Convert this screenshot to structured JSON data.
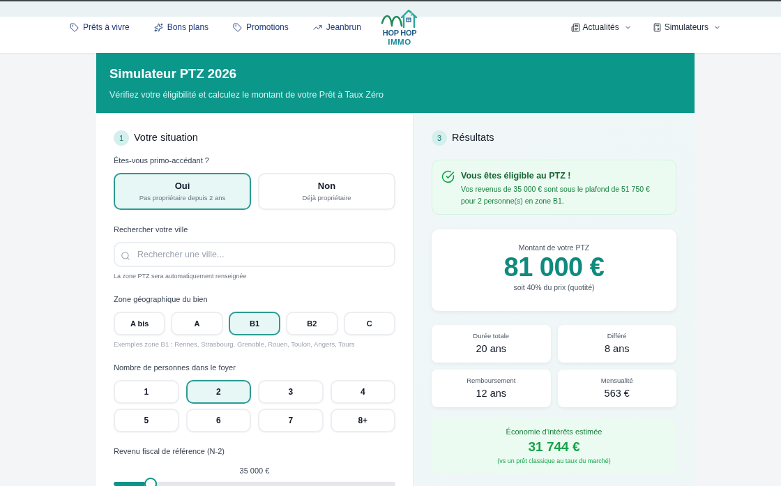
{
  "header": {
    "nav_links": [
      {
        "label": "Prêts à vivre"
      },
      {
        "label": "Bons plans"
      },
      {
        "label": "Promotions"
      },
      {
        "label": "Jeanbrun"
      }
    ],
    "logo": {
      "line_1": "HOP HOP",
      "line_2": "IMMO"
    },
    "menus": [
      {
        "label": "Actualités"
      },
      {
        "label": "Simulateurs"
      }
    ]
  },
  "hero": {
    "title": "Simulateur PTZ 2026",
    "subtitle": "Vérifiez votre éligibilité et calculez le montant de votre Prêt à Taux Zéro"
  },
  "form": {
    "step": "1",
    "title": "Votre situation",
    "primo": {
      "question": "Êtes-vous primo-accédant ?",
      "options": [
        {
          "label": "Oui",
          "description": "Pas propriétaire depuis 2 ans",
          "selected": true
        },
        {
          "label": "Non",
          "description": "Déjà propriétaire",
          "selected": false
        }
      ]
    },
    "city": {
      "label": "Rechercher votre ville",
      "placeholder": "Rechercher une ville...",
      "hint": "La zone PTZ sera automatiquement renseignée"
    },
    "zone": {
      "label": "Zone géographique du bien",
      "options": [
        {
          "label": "A bis",
          "selected": false
        },
        {
          "label": "A",
          "selected": false
        },
        {
          "label": "B1",
          "selected": true
        },
        {
          "label": "B2",
          "selected": false
        },
        {
          "label": "C",
          "selected": false
        }
      ],
      "examples": "Exemples zone B1 : Rennes, Strasbourg, Grenoble, Rouen, Toulon, Angers, Tours"
    },
    "household": {
      "label": "Nombre de personnes dans le foyer",
      "options": [
        {
          "label": "1",
          "selected": false
        },
        {
          "label": "2",
          "selected": true
        },
        {
          "label": "3",
          "selected": false
        },
        {
          "label": "4",
          "selected": false
        },
        {
          "label": "5",
          "selected": false
        },
        {
          "label": "6",
          "selected": false
        },
        {
          "label": "7",
          "selected": false
        },
        {
          "label": "8+",
          "selected": false
        }
      ]
    },
    "income": {
      "label": "Revenu fiscal de référence (N-2)",
      "reading": "35 000 €",
      "level": 0.13
    }
  },
  "results": {
    "step": "3",
    "title": "Résultats",
    "eligibility": {
      "title": "Vous êtes éligible au PTZ !",
      "message": "Vos revenus de 35 000 € sont sous le plafond de 51 750 € pour 2 personne(s) en zone B1."
    },
    "amount": {
      "label": "Montant de votre PTZ",
      "value": "81 000 €",
      "note": "soit 40% du prix (quotité)"
    },
    "stats": [
      {
        "label": "Durée totale",
        "value": "20 ans"
      },
      {
        "label": "Différé",
        "value": "8 ans"
      },
      {
        "label": "Remboursement",
        "value": "12 ans"
      },
      {
        "label": "Mensualité",
        "value": "563 €"
      }
    ],
    "savings": {
      "label": "Économie d'intérêts estimée",
      "value": "31 744 €",
      "note": "(vs un prêt classique au taux du marché)"
    }
  }
}
